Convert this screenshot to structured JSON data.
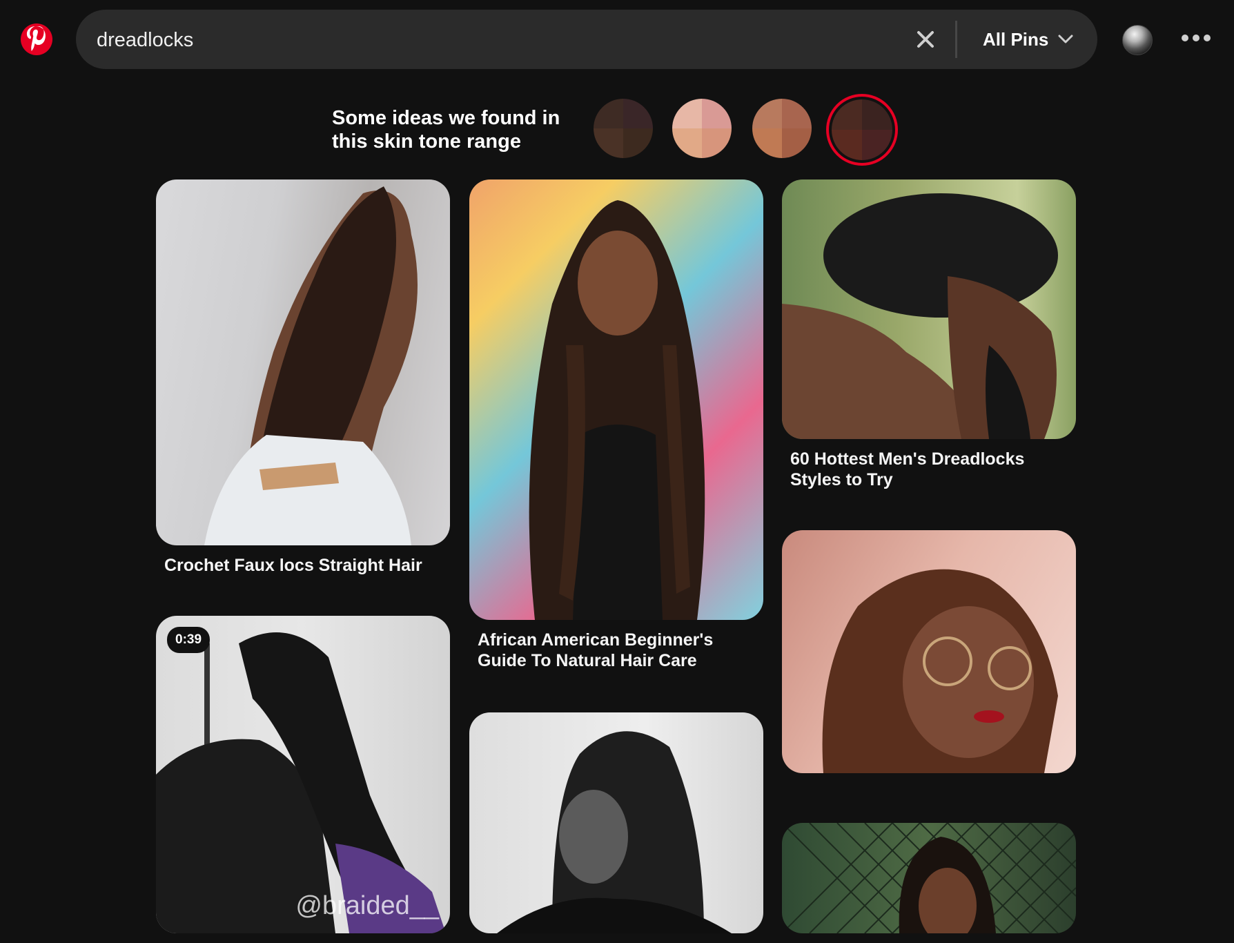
{
  "search": {
    "query": "dreadlocks",
    "filter_label": "All Pins"
  },
  "skin_tone": {
    "title_line1": "Some ideas we found in",
    "title_line2": "this skin tone range",
    "swatches": [
      {
        "colors": [
          "#3e2b24",
          "#3a2628",
          "#4a3226",
          "#3d2a1f"
        ]
      },
      {
        "colors": [
          "#e7b7a6",
          "#d99a95",
          "#e1a987",
          "#d7957c"
        ]
      },
      {
        "colors": [
          "#b87a5e",
          "#a8654f",
          "#c07a54",
          "#a45f45"
        ]
      },
      {
        "colors": [
          "#4b2a22",
          "#3b2320",
          "#5a2a20",
          "#4a2323"
        ],
        "selected": true
      }
    ]
  },
  "pins": [
    {
      "caption": "Crochet Faux locs Straight Hair"
    },
    {
      "caption": "African American Beginner's Guide To Natural Hair Care"
    },
    {
      "caption": "60 Hottest Men's Dreadlocks Styles to Try"
    },
    {
      "caption": ""
    },
    {
      "caption": "",
      "badge": "0:39",
      "watermark": "@braided__"
    },
    {
      "caption": ""
    },
    {
      "caption": ""
    }
  ],
  "colors": {
    "brand": "#e60023",
    "background": "#111111",
    "search_bg": "#2b2b2b"
  }
}
